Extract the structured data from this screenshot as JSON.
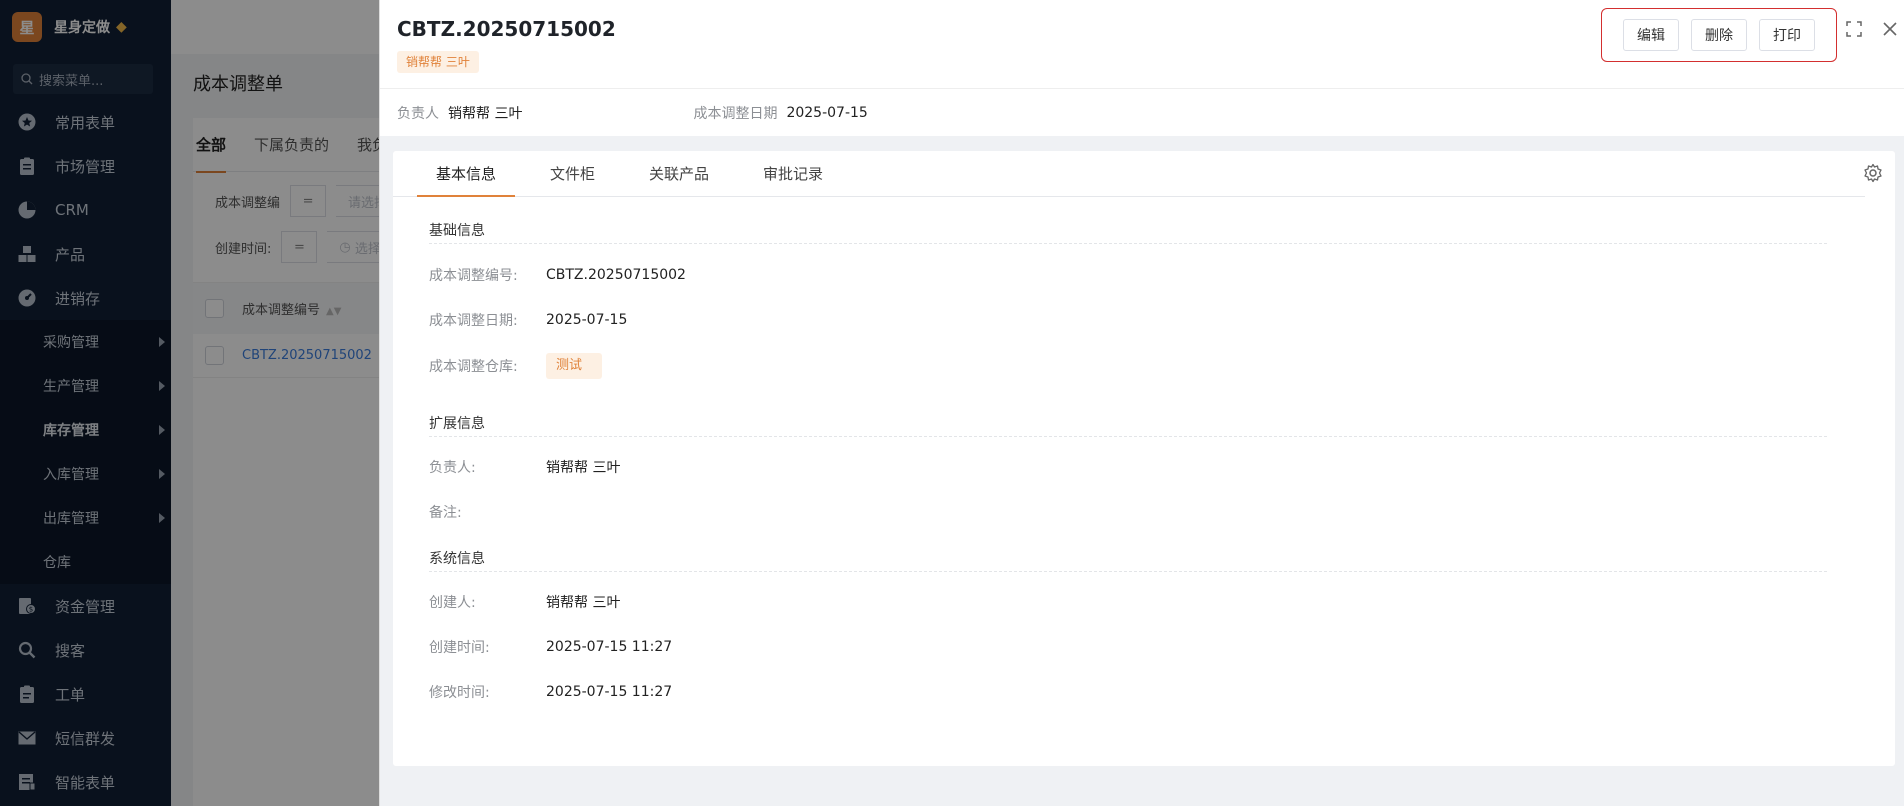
{
  "sidebar": {
    "brand_logo": "星",
    "brand_name": "星身定做",
    "search_placeholder": "搜索菜单...",
    "items": [
      {
        "label": "常用表单",
        "icon": "star-icon"
      },
      {
        "label": "市场管理",
        "icon": "clipboard-icon"
      },
      {
        "label": "CRM",
        "icon": "pie-icon"
      },
      {
        "label": "产品",
        "icon": "blocks-icon"
      },
      {
        "label": "进销存",
        "icon": "dashboard-icon"
      }
    ],
    "sub_items": [
      {
        "label": "采购管理",
        "arrow": true,
        "bold": false
      },
      {
        "label": "生产管理",
        "arrow": true,
        "bold": false
      },
      {
        "label": "库存管理",
        "arrow": true,
        "bold": true
      },
      {
        "label": "入库管理",
        "arrow": true,
        "bold": false
      },
      {
        "label": "出库管理",
        "arrow": true,
        "bold": false
      },
      {
        "label": "仓库",
        "arrow": false,
        "bold": false
      }
    ],
    "items_after": [
      {
        "label": "资金管理",
        "icon": "money-icon"
      },
      {
        "label": "搜客",
        "icon": "search-icon"
      },
      {
        "label": "工单",
        "icon": "ticket-icon"
      },
      {
        "label": "短信群发",
        "icon": "mail-icon"
      },
      {
        "label": "智能表单",
        "icon": "form-icon"
      }
    ]
  },
  "background_page": {
    "title": "成本调整单",
    "tabs": [
      "全部",
      "下属负责的",
      "我负"
    ],
    "filter1_label": "成本调整编",
    "filter1_placeholder": "请选择",
    "filter2_label": "创建时间:",
    "filter2_placeholder": "选择",
    "eq": "=",
    "table_header": "成本调整编号",
    "row_link": "CBTZ.20250715002"
  },
  "drawer": {
    "title": "CBTZ.20250715002",
    "owner_tag": "销帮帮 三叶",
    "actions": {
      "edit": "编辑",
      "delete": "删除",
      "print": "打印"
    },
    "summary": {
      "owner_label": "负责人",
      "owner_value": "销帮帮 三叶",
      "date_label": "成本调整日期",
      "date_value": "2025-07-15"
    },
    "tabs": [
      "基本信息",
      "文件柜",
      "关联产品",
      "审批记录"
    ],
    "sections": {
      "basic": "基础信息",
      "extended": "扩展信息",
      "system": "系统信息"
    },
    "fields": {
      "number_label": "成本调整编号:",
      "number_value": "CBTZ.20250715002",
      "date_label": "成本调整日期:",
      "date_value": "2025-07-15",
      "warehouse_label": "成本调整仓库:",
      "warehouse_value": "测试",
      "owner_label": "负责人:",
      "owner_value": "销帮帮 三叶",
      "remark_label": "备注:",
      "remark_value": "",
      "creator_label": "创建人:",
      "creator_value": "销帮帮 三叶",
      "created_label": "创建时间:",
      "created_value": "2025-07-15 11:27",
      "modified_label": "修改时间:",
      "modified_value": "2025-07-15 11:27"
    }
  }
}
